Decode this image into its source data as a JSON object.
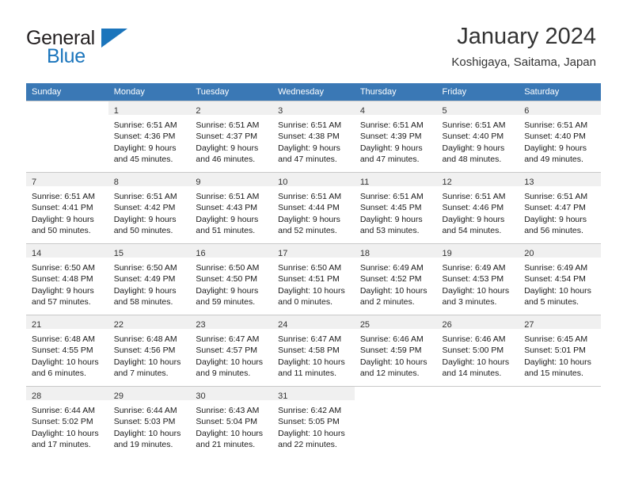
{
  "brand": {
    "name_part1": "General",
    "name_part2": "Blue"
  },
  "header": {
    "month_title": "January 2024",
    "location": "Koshigaya, Saitama, Japan"
  },
  "colors": {
    "header_row_bg": "#3a78b5",
    "daynum_strip_bg": "#f0f0f0",
    "brand_blue": "#1b75bc",
    "grid_line": "#c9c9c9"
  },
  "calendar": {
    "weekday_headers": [
      "Sunday",
      "Monday",
      "Tuesday",
      "Wednesday",
      "Thursday",
      "Friday",
      "Saturday"
    ],
    "weeks": [
      [
        {
          "empty": true
        },
        {
          "day": "1",
          "sunrise": "Sunrise: 6:51 AM",
          "sunset": "Sunset: 4:36 PM",
          "daylight1": "Daylight: 9 hours",
          "daylight2": "and 45 minutes."
        },
        {
          "day": "2",
          "sunrise": "Sunrise: 6:51 AM",
          "sunset": "Sunset: 4:37 PM",
          "daylight1": "Daylight: 9 hours",
          "daylight2": "and 46 minutes."
        },
        {
          "day": "3",
          "sunrise": "Sunrise: 6:51 AM",
          "sunset": "Sunset: 4:38 PM",
          "daylight1": "Daylight: 9 hours",
          "daylight2": "and 47 minutes."
        },
        {
          "day": "4",
          "sunrise": "Sunrise: 6:51 AM",
          "sunset": "Sunset: 4:39 PM",
          "daylight1": "Daylight: 9 hours",
          "daylight2": "and 47 minutes."
        },
        {
          "day": "5",
          "sunrise": "Sunrise: 6:51 AM",
          "sunset": "Sunset: 4:40 PM",
          "daylight1": "Daylight: 9 hours",
          "daylight2": "and 48 minutes."
        },
        {
          "day": "6",
          "sunrise": "Sunrise: 6:51 AM",
          "sunset": "Sunset: 4:40 PM",
          "daylight1": "Daylight: 9 hours",
          "daylight2": "and 49 minutes."
        }
      ],
      [
        {
          "day": "7",
          "sunrise": "Sunrise: 6:51 AM",
          "sunset": "Sunset: 4:41 PM",
          "daylight1": "Daylight: 9 hours",
          "daylight2": "and 50 minutes."
        },
        {
          "day": "8",
          "sunrise": "Sunrise: 6:51 AM",
          "sunset": "Sunset: 4:42 PM",
          "daylight1": "Daylight: 9 hours",
          "daylight2": "and 50 minutes."
        },
        {
          "day": "9",
          "sunrise": "Sunrise: 6:51 AM",
          "sunset": "Sunset: 4:43 PM",
          "daylight1": "Daylight: 9 hours",
          "daylight2": "and 51 minutes."
        },
        {
          "day": "10",
          "sunrise": "Sunrise: 6:51 AM",
          "sunset": "Sunset: 4:44 PM",
          "daylight1": "Daylight: 9 hours",
          "daylight2": "and 52 minutes."
        },
        {
          "day": "11",
          "sunrise": "Sunrise: 6:51 AM",
          "sunset": "Sunset: 4:45 PM",
          "daylight1": "Daylight: 9 hours",
          "daylight2": "and 53 minutes."
        },
        {
          "day": "12",
          "sunrise": "Sunrise: 6:51 AM",
          "sunset": "Sunset: 4:46 PM",
          "daylight1": "Daylight: 9 hours",
          "daylight2": "and 54 minutes."
        },
        {
          "day": "13",
          "sunrise": "Sunrise: 6:51 AM",
          "sunset": "Sunset: 4:47 PM",
          "daylight1": "Daylight: 9 hours",
          "daylight2": "and 56 minutes."
        }
      ],
      [
        {
          "day": "14",
          "sunrise": "Sunrise: 6:50 AM",
          "sunset": "Sunset: 4:48 PM",
          "daylight1": "Daylight: 9 hours",
          "daylight2": "and 57 minutes."
        },
        {
          "day": "15",
          "sunrise": "Sunrise: 6:50 AM",
          "sunset": "Sunset: 4:49 PM",
          "daylight1": "Daylight: 9 hours",
          "daylight2": "and 58 minutes."
        },
        {
          "day": "16",
          "sunrise": "Sunrise: 6:50 AM",
          "sunset": "Sunset: 4:50 PM",
          "daylight1": "Daylight: 9 hours",
          "daylight2": "and 59 minutes."
        },
        {
          "day": "17",
          "sunrise": "Sunrise: 6:50 AM",
          "sunset": "Sunset: 4:51 PM",
          "daylight1": "Daylight: 10 hours",
          "daylight2": "and 0 minutes."
        },
        {
          "day": "18",
          "sunrise": "Sunrise: 6:49 AM",
          "sunset": "Sunset: 4:52 PM",
          "daylight1": "Daylight: 10 hours",
          "daylight2": "and 2 minutes."
        },
        {
          "day": "19",
          "sunrise": "Sunrise: 6:49 AM",
          "sunset": "Sunset: 4:53 PM",
          "daylight1": "Daylight: 10 hours",
          "daylight2": "and 3 minutes."
        },
        {
          "day": "20",
          "sunrise": "Sunrise: 6:49 AM",
          "sunset": "Sunset: 4:54 PM",
          "daylight1": "Daylight: 10 hours",
          "daylight2": "and 5 minutes."
        }
      ],
      [
        {
          "day": "21",
          "sunrise": "Sunrise: 6:48 AM",
          "sunset": "Sunset: 4:55 PM",
          "daylight1": "Daylight: 10 hours",
          "daylight2": "and 6 minutes."
        },
        {
          "day": "22",
          "sunrise": "Sunrise: 6:48 AM",
          "sunset": "Sunset: 4:56 PM",
          "daylight1": "Daylight: 10 hours",
          "daylight2": "and 7 minutes."
        },
        {
          "day": "23",
          "sunrise": "Sunrise: 6:47 AM",
          "sunset": "Sunset: 4:57 PM",
          "daylight1": "Daylight: 10 hours",
          "daylight2": "and 9 minutes."
        },
        {
          "day": "24",
          "sunrise": "Sunrise: 6:47 AM",
          "sunset": "Sunset: 4:58 PM",
          "daylight1": "Daylight: 10 hours",
          "daylight2": "and 11 minutes."
        },
        {
          "day": "25",
          "sunrise": "Sunrise: 6:46 AM",
          "sunset": "Sunset: 4:59 PM",
          "daylight1": "Daylight: 10 hours",
          "daylight2": "and 12 minutes."
        },
        {
          "day": "26",
          "sunrise": "Sunrise: 6:46 AM",
          "sunset": "Sunset: 5:00 PM",
          "daylight1": "Daylight: 10 hours",
          "daylight2": "and 14 minutes."
        },
        {
          "day": "27",
          "sunrise": "Sunrise: 6:45 AM",
          "sunset": "Sunset: 5:01 PM",
          "daylight1": "Daylight: 10 hours",
          "daylight2": "and 15 minutes."
        }
      ],
      [
        {
          "day": "28",
          "sunrise": "Sunrise: 6:44 AM",
          "sunset": "Sunset: 5:02 PM",
          "daylight1": "Daylight: 10 hours",
          "daylight2": "and 17 minutes."
        },
        {
          "day": "29",
          "sunrise": "Sunrise: 6:44 AM",
          "sunset": "Sunset: 5:03 PM",
          "daylight1": "Daylight: 10 hours",
          "daylight2": "and 19 minutes."
        },
        {
          "day": "30",
          "sunrise": "Sunrise: 6:43 AM",
          "sunset": "Sunset: 5:04 PM",
          "daylight1": "Daylight: 10 hours",
          "daylight2": "and 21 minutes."
        },
        {
          "day": "31",
          "sunrise": "Sunrise: 6:42 AM",
          "sunset": "Sunset: 5:05 PM",
          "daylight1": "Daylight: 10 hours",
          "daylight2": "and 22 minutes."
        },
        {
          "empty": true
        },
        {
          "empty": true
        },
        {
          "empty": true
        }
      ]
    ]
  }
}
